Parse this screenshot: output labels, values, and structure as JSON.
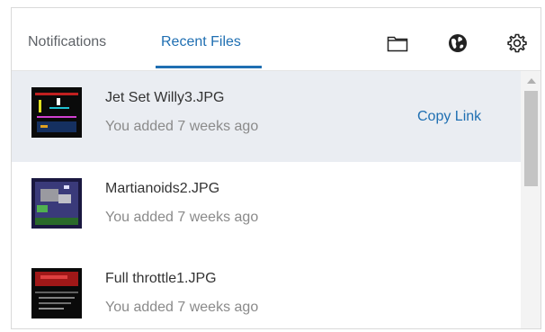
{
  "tabs": {
    "notifications": "Notifications",
    "recent_files": "Recent Files"
  },
  "header_icons": [
    "folder-icon",
    "globe-icon",
    "gear-icon"
  ],
  "colors": {
    "accent": "#1f6fb2",
    "selected_row": "#eaedf2"
  },
  "files": [
    {
      "name": "Jet Set Willy3.JPG",
      "added": "You added 7 weeks ago",
      "action": "Copy Link"
    },
    {
      "name": "Martianoids2.JPG",
      "added": "You added 7 weeks ago"
    },
    {
      "name": "Full throttle1.JPG",
      "added": "You added 7 weeks ago"
    }
  ]
}
